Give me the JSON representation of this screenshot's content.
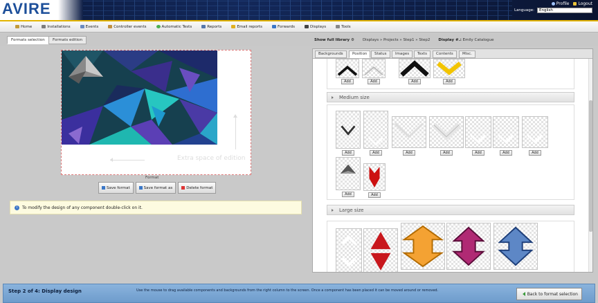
{
  "app": {
    "logo_text": "AVIRE",
    "top_links": [
      {
        "label": "Profile",
        "icon": "user-icon"
      },
      {
        "label": "Logout",
        "icon": "key-icon"
      }
    ],
    "language_label": "Language:",
    "language_value": "English"
  },
  "menu": {
    "items": [
      {
        "label": "Home",
        "icon": "home-icon",
        "color": "#c29a3a"
      },
      {
        "label": "Installations",
        "icon": "installations-icon",
        "color": "#7c7c7c"
      },
      {
        "label": "Events",
        "icon": "events-icon",
        "color": "#6a8bc0"
      },
      {
        "label": "Controller events",
        "icon": "controller-events-icon",
        "color": "#c09040"
      },
      {
        "label": "Automatic Tests",
        "icon": "automatic-tests-icon",
        "color": "#4caf50"
      },
      {
        "label": "Reports",
        "icon": "reports-icon",
        "color": "#5577aa"
      },
      {
        "label": "Email reports",
        "icon": "email-reports-icon",
        "color": "#e0b020"
      },
      {
        "label": "Forwards",
        "icon": "forwards-icon",
        "color": "#3a77c7"
      },
      {
        "label": "Displays",
        "icon": "displays-icon",
        "color": "#444444"
      },
      {
        "label": "Tools",
        "icon": "tools-icon",
        "color": "#888888"
      }
    ]
  },
  "tabs": {
    "items": [
      {
        "label": "Formats selection",
        "active": true
      },
      {
        "label": "Formats edition",
        "active": false
      }
    ]
  },
  "crumbs": {
    "show_library": "Show full library",
    "path": "Displays » Projects » Step1 » Step2",
    "display_label": "Display #.:",
    "display_value": "Emily Catalogue"
  },
  "editor": {
    "extra_space_text": "Extra space of edition",
    "format_label": "Format",
    "buttons": [
      {
        "label": "Save format",
        "icon": "save-icon"
      },
      {
        "label": "Save format as",
        "icon": "save-as-icon"
      },
      {
        "label": "Delete format",
        "icon": "delete-icon"
      }
    ],
    "info_text": "To modify the design of any component double-click on it."
  },
  "library": {
    "tabs": [
      "Backgrounds",
      "Position",
      "Status",
      "Images",
      "Texts",
      "Contents",
      "Misc."
    ],
    "active_tab": "Position",
    "add_label": "Add",
    "sections": [
      {
        "title": "Medium size"
      },
      {
        "title": "Large size"
      }
    ]
  },
  "footer": {
    "step_text": "Step 2 of 4: Display design",
    "hint_text": "Use the mouse to drag available components and backgrounds from the right column to the screen. Once a component has been placed it can be moved around or removed.",
    "back_label": "Back to format selection"
  }
}
